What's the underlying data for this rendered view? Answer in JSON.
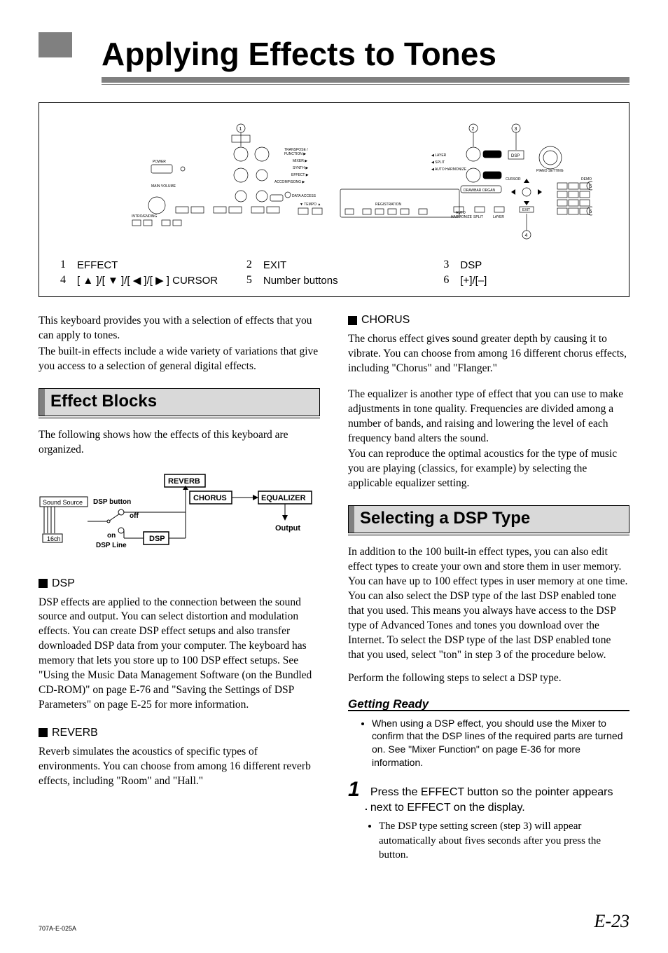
{
  "title": "Applying Effects to Tones",
  "legend": {
    "r1c1": {
      "n": "1",
      "t": "EFFECT"
    },
    "r1c2": {
      "n": "2",
      "t": "EXIT"
    },
    "r1c3": {
      "n": "3",
      "t": "DSP"
    },
    "r2c1": {
      "n": "4",
      "t": "[ ▲ ]/[ ▼ ]/[ ◀ ]/[ ▶ ] CURSOR"
    },
    "r2c2": {
      "n": "5",
      "t": "Number buttons"
    },
    "r2c3": {
      "n": "6",
      "t": "[+]/[–]"
    }
  },
  "intro": {
    "p1": "This keyboard provides you with a selection of effects that you can apply to tones.",
    "p2": "The built-in effects include a wide variety of variations that give you access to a selection of general digital effects."
  },
  "effectBlocks": {
    "heading": "Effect Blocks",
    "p1": "The following shows how the effects of this keyboard are organized."
  },
  "blockDiagram": {
    "soundSource": "Sound Source",
    "ch": "16ch",
    "dspButton": "DSP button",
    "off": "off",
    "on": "on",
    "dspLine": "DSP Line",
    "dsp": "DSP",
    "reverb": "REVERB",
    "chorus": "CHORUS",
    "equalizer": "EQUALIZER",
    "output": "Output"
  },
  "dsp": {
    "heading": "DSP",
    "p1": "DSP effects are applied to the connection between the sound source and output. You can select distortion and modulation effects. You can create DSP effect setups and also transfer downloaded DSP data from your computer. The keyboard has memory that lets you store up to 100 DSP effect setups. See \"Using the Music Data Management Software (on the Bundled CD-ROM)\" on page E-76 and \"Saving the Settings of DSP Parameters\" on page E-25 for more information."
  },
  "reverb": {
    "heading": "REVERB",
    "p1": "Reverb simulates the acoustics of specific types of environments. You can choose from among 16 different reverb effects, including \"Room\" and \"Hall.\""
  },
  "chorus": {
    "heading": "CHORUS",
    "p1": "The chorus effect gives sound greater depth by causing it to vibrate. You can choose from among 16 different chorus effects, including \"Chorus\" and \"Flanger.\""
  },
  "eqText": {
    "p1": "The equalizer is another type of effect that you can use to make adjustments in tone quality. Frequencies are divided among a number of bands, and raising and lowering the level of each frequency band alters the sound.",
    "p2": "You can reproduce the optimal acoustics for the type of music you are playing (classics, for example) by selecting the applicable equalizer setting."
  },
  "selecting": {
    "heading": "Selecting a DSP Type",
    "p1": "In addition to the 100 built-in effect types, you can also edit effect types to create your own and store them in user memory. You can have up to 100 effect types in user memory at one time. You can also select the DSP type of the last DSP enabled tone that you used. This means you always have access to the DSP type of Advanced Tones and tones you download over the Internet. To select the DSP type of the last DSP enabled tone that you used, select \"ton\" in step 3 of the procedure below.",
    "p2": "Perform the following steps to select a DSP type."
  },
  "gettingReady": {
    "label": "Getting Ready",
    "bullet": "When using a DSP effect, you should use the Mixer to confirm that the DSP lines of the required parts are turned on. See \"Mixer Function\" on page E-36 for more information."
  },
  "step1": {
    "num": "1",
    "dot": ".",
    "text": "Press the EFFECT button so the pointer appears next to EFFECT on the display.",
    "sub": "The DSP type setting screen (step 3) will appear automatically about fives seconds after you press the button."
  },
  "footer": {
    "code": "707A-E-025A",
    "page": "E-23"
  }
}
